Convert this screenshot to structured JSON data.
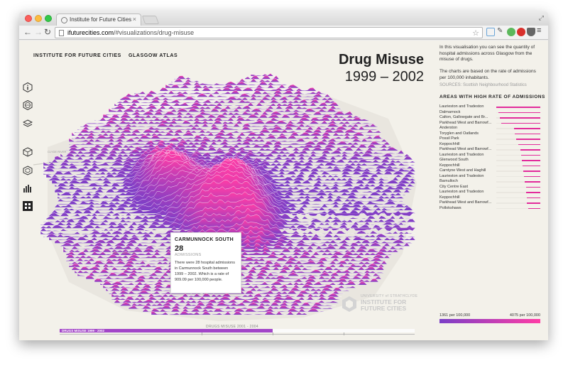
{
  "browser": {
    "tab_title": "Institute for Future Cities",
    "url_host": "ifuturecities.com",
    "url_path": "/#visualizations/drug-misuse"
  },
  "header": {
    "brand": "INSTITUTE FOR FUTURE CITIES",
    "atlas": "GLASGOW ATLAS",
    "title": "Drug Misuse",
    "subtitle": "1999 – 2002"
  },
  "sidebar": {
    "icons": [
      "info-icon",
      "globe-icon",
      "layers-icon",
      "cube-icon",
      "cube-outline-icon",
      "bar-chart-icon",
      "grid-icon"
    ]
  },
  "map": {
    "labels": [
      "CLYDE RIVER",
      "POLLOCK PARK"
    ]
  },
  "tooltip": {
    "name": "CARMUNNOCK SOUTH",
    "value": "28",
    "label": "ADMISSIONS",
    "description": "There were 28 hospital admissions in Carmunnock South between 1999 – 2002. Which is a rate of 909.09 per 100,000 people."
  },
  "logo": {
    "line1": "UNIVERSITY of STRATHCLYDE",
    "line2": "INSTITUTE FOR FUTURE CITIES"
  },
  "timeline": {
    "label": "DRUGS MISUSE 2001 - 2004",
    "active": "DRUGS MISUSE 1999 - 2002",
    "progress": 0.6
  },
  "panel": {
    "intro": "In this visualisation you can see the quantity of hospital admissions across Glasgow from the misuse of drugs.",
    "intro2": "The charts are based on the rate of admissions per 100,000 inhabitants.",
    "sources": "SOURCES: Scottish Neighbourhood Statistics",
    "areas_title": "AREAS WITH HIGH RATE OF ADMISSIONS",
    "areas": [
      {
        "name": "Laurieston and Tradeston",
        "value": 1.0
      },
      {
        "name": "Dalmarnock",
        "value": 0.95
      },
      {
        "name": "Calton, Gallowgate and Br...",
        "value": 0.92
      },
      {
        "name": "Parkhead West and Barrowf...",
        "value": 0.88
      },
      {
        "name": "Anderston",
        "value": 0.6
      },
      {
        "name": "Toryglen and Oatlands",
        "value": 0.58
      },
      {
        "name": "Possil Park",
        "value": 0.55
      },
      {
        "name": "Keppochhill",
        "value": 0.5
      },
      {
        "name": "Parkhead West and Barrowf...",
        "value": 0.45
      },
      {
        "name": "Laurieston and Tradeston",
        "value": 0.44
      },
      {
        "name": "Glenwood South",
        "value": 0.42
      },
      {
        "name": "Keppochhill",
        "value": 0.4
      },
      {
        "name": "Carntyne West and Haghill",
        "value": 0.38
      },
      {
        "name": "Laurieston and Tradeston",
        "value": 0.37
      },
      {
        "name": "Barnulloch",
        "value": 0.35
      },
      {
        "name": "City Centre East",
        "value": 0.33
      },
      {
        "name": "Laurieston and Tradeston",
        "value": 0.32
      },
      {
        "name": "Keppochhill",
        "value": 0.3
      },
      {
        "name": "Parkhead West and Barrowf...",
        "value": 0.3
      },
      {
        "name": "Pollokshaws",
        "value": 0.28
      }
    ],
    "legend_min": "1361 per 100,000",
    "legend_max": "4075 per 100,000"
  },
  "colors": {
    "low": "#7b3fc7",
    "high": "#ff3da6",
    "accent": "#a245c8"
  }
}
